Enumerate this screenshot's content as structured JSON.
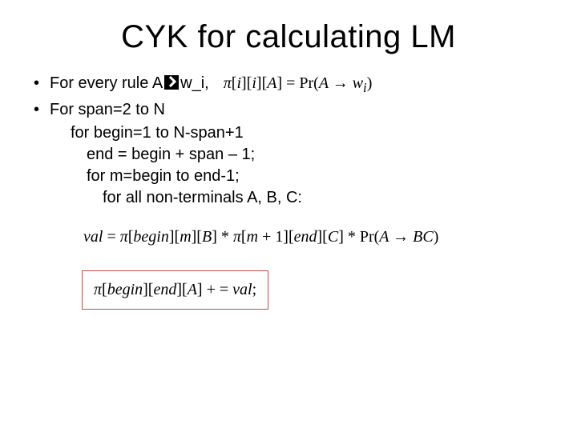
{
  "title": "CYK for calculating LM",
  "bullets": {
    "rule_prefix": "For every rule A",
    "rule_suffix": "w_i,",
    "rule_formula": "π[i][i][A] = Pr(A → w_i)",
    "span": "For span=2 to N",
    "begin": "for begin=1 to N-span+1",
    "end": "end = begin + span – 1;",
    "m": "for m=begin to end-1;",
    "nonterm": "for all non-terminals  A, B, C:"
  },
  "val_eq": "val = π[begin][m][B] * π[m + 1][end][C] * Pr(A → BC)",
  "update_eq": "π[begin][end][A] += val;"
}
